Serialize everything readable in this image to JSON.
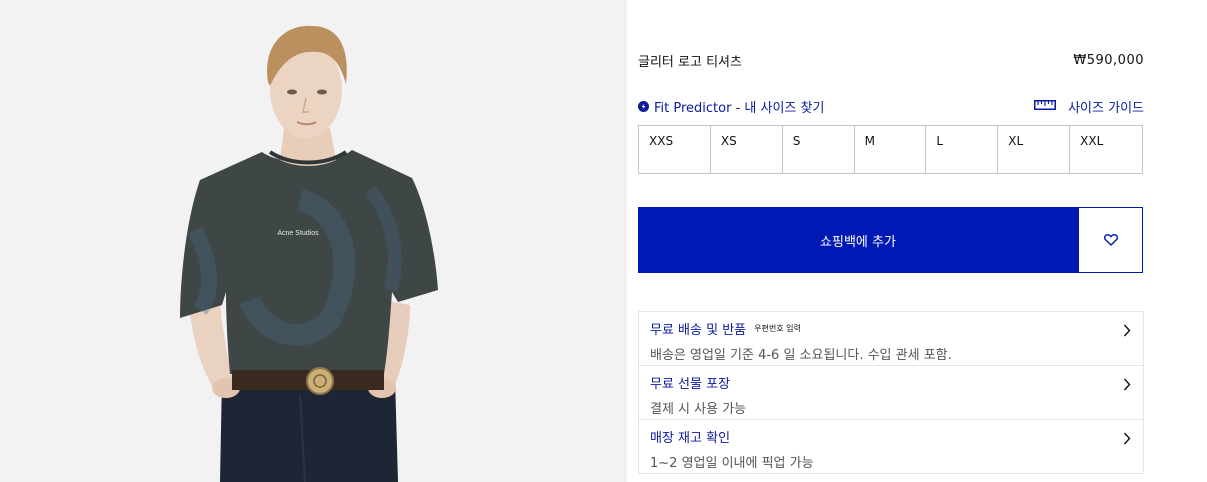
{
  "product": {
    "name": "글리터 로고 티셔츠",
    "price": "₩590,000",
    "brand_print": "Acne Studios"
  },
  "fit": {
    "predictor_label": "Fit Predictor - 내 사이즈 찾기",
    "size_guide_label": "사이즈 가이드"
  },
  "sizes": [
    "XXS",
    "XS",
    "S",
    "M",
    "L",
    "XL",
    "XXL"
  ],
  "cart": {
    "add_label": "쇼핑백에 추가"
  },
  "info": [
    {
      "title": "무료 배송 및 반품",
      "link": "우편번호 입력",
      "desc": "배송은 영업일 기준 4-6 일 소요됩니다. 수입 관세 포함."
    },
    {
      "title": "무료 선물 포장",
      "link": "",
      "desc": "결제 시 사용 가능"
    },
    {
      "title": "매장 재고 확인",
      "link": "",
      "desc": "1~2 영업일 이내에 픽업 가능"
    }
  ],
  "colors": {
    "accent": "#0019b4",
    "link": "#0a1a9e",
    "image_bg": "#f2f2f2",
    "tshirt": "#3e4646"
  }
}
